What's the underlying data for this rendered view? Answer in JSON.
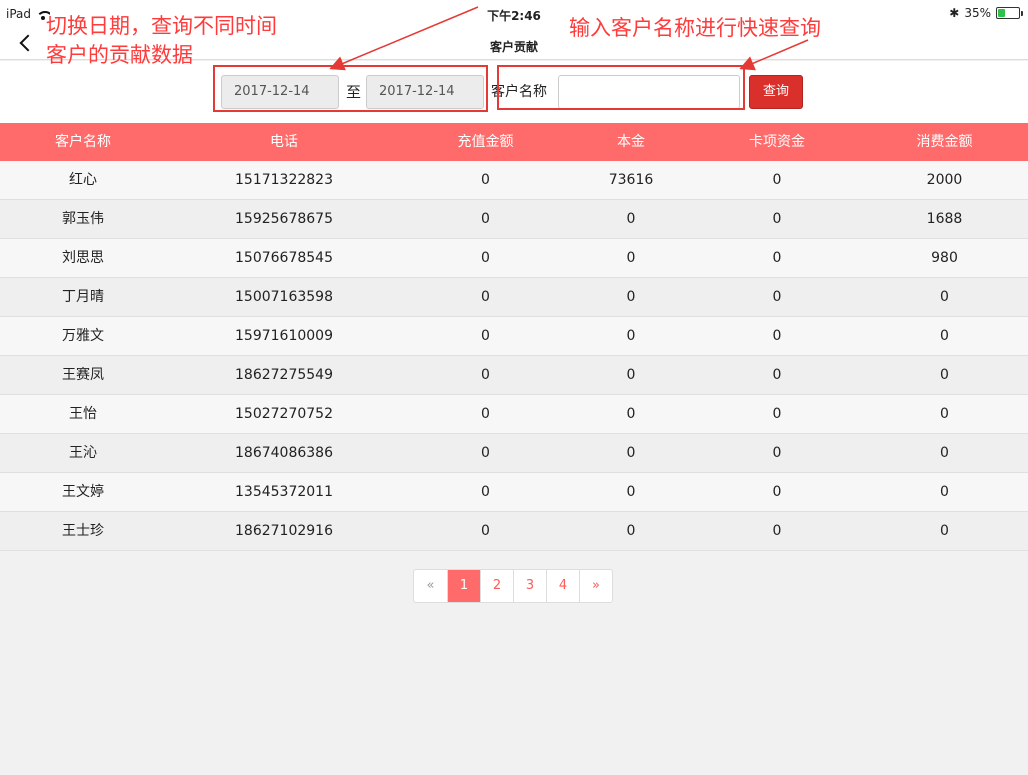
{
  "status_bar": {
    "device": "iPad",
    "time": "下午2:46",
    "battery": "35%",
    "battery_level": 0.35,
    "bluetooth": "✱"
  },
  "nav": {
    "title": "客户贡献"
  },
  "filter": {
    "date_from": "2017-12-14",
    "separator": "至",
    "date_to": "2017-12-14",
    "name_label": "客户名称",
    "name_value": "",
    "query_label": "查询"
  },
  "table": {
    "headers": [
      "客户名称",
      "电话",
      "充值金额",
      "本金",
      "卡项资金",
      "消费金额"
    ],
    "rows": [
      [
        "红心",
        "15171322823",
        "0",
        "73616",
        "0",
        "2000"
      ],
      [
        "郭玉伟",
        "15925678675",
        "0",
        "0",
        "0",
        "1688"
      ],
      [
        "刘思思",
        "15076678545",
        "0",
        "0",
        "0",
        "980"
      ],
      [
        "丁月晴",
        "15007163598",
        "0",
        "0",
        "0",
        "0"
      ],
      [
        "万雅文",
        "15971610009",
        "0",
        "0",
        "0",
        "0"
      ],
      [
        "王赛凤",
        "18627275549",
        "0",
        "0",
        "0",
        "0"
      ],
      [
        "王怡",
        "15027270752",
        "0",
        "0",
        "0",
        "0"
      ],
      [
        "王沁",
        "18674086386",
        "0",
        "0",
        "0",
        "0"
      ],
      [
        "王文婷",
        "13545372011",
        "0",
        "0",
        "0",
        "0"
      ],
      [
        "王士珍",
        "18627102916",
        "0",
        "0",
        "0",
        "0"
      ]
    ]
  },
  "pagination": {
    "prev": "«",
    "pages": [
      "1",
      "2",
      "3",
      "4"
    ],
    "current": "1",
    "next": "»"
  },
  "annotations": {
    "left_line1": "切换日期，查询不同时间",
    "left_line2": "客户的贡献数据",
    "right": "输入客户名称进行快速查询",
    "color": "#ff3b3b"
  },
  "colors": {
    "header_bg": "#ff6b6b",
    "query_btn": "#d9302c"
  }
}
